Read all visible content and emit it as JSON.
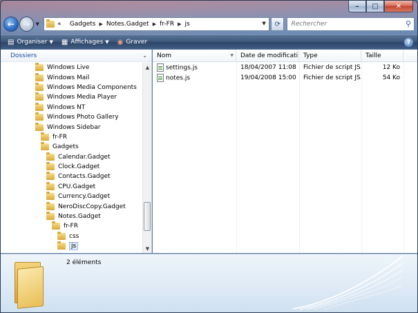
{
  "window": {
    "caption_buttons": {
      "minimize": "–",
      "maximize": "□",
      "close": "✕"
    }
  },
  "nav": {
    "back_icon": "back-arrow-icon",
    "forward_icon": "forward-arrow-icon",
    "address": {
      "prefix": "«",
      "crumbs": [
        "Gadgets",
        "Notes.Gadget",
        "fr-FR",
        "js"
      ]
    },
    "search_placeholder": "Rechercher"
  },
  "toolbar": {
    "organize": "Organiser",
    "views": "Affichages",
    "burn": "Graver"
  },
  "folders_pane": {
    "title": "Dossiers",
    "items": [
      {
        "label": "Windows Live",
        "indent": 1
      },
      {
        "label": "Windows Mail",
        "indent": 1
      },
      {
        "label": "Windows Media Components",
        "indent": 1
      },
      {
        "label": "Windows Media Player",
        "indent": 1
      },
      {
        "label": "Windows NT",
        "indent": 1
      },
      {
        "label": "Windows Photo Gallery",
        "indent": 1
      },
      {
        "label": "Windows Sidebar",
        "indent": 1
      },
      {
        "label": "fr-FR",
        "indent": 2
      },
      {
        "label": "Gadgets",
        "indent": 2
      },
      {
        "label": "Calendar.Gadget",
        "indent": 3
      },
      {
        "label": "Clock.Gadget",
        "indent": 3
      },
      {
        "label": "Contacts.Gadget",
        "indent": 3
      },
      {
        "label": "CPU.Gadget",
        "indent": 3
      },
      {
        "label": "Currency.Gadget",
        "indent": 3
      },
      {
        "label": "NeroDiscCopy.Gadget",
        "indent": 3
      },
      {
        "label": "Notes.Gadget",
        "indent": 3
      },
      {
        "label": "fr-FR",
        "indent": 4
      },
      {
        "label": "css",
        "indent": 5
      },
      {
        "label": "js",
        "indent": 5,
        "selected": true
      }
    ]
  },
  "file_list": {
    "columns": [
      "Nom",
      "Date de modificati...",
      "Type",
      "Taille"
    ],
    "rows": [
      {
        "name": "settings.js",
        "date": "18/04/2007 11:08",
        "type": "Fichier de script JS...",
        "size": "12 Ko"
      },
      {
        "name": "notes.js",
        "date": "19/04/2008 15:00",
        "type": "Fichier de script JS...",
        "size": "54 Ko"
      }
    ]
  },
  "details": {
    "count": "2 éléments"
  }
}
